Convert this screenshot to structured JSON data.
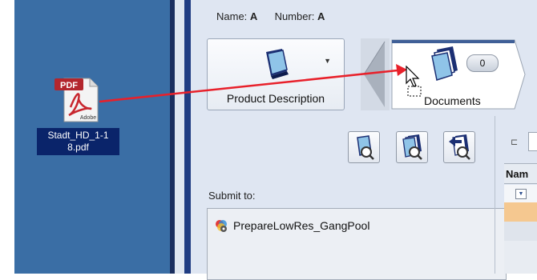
{
  "desktop": {
    "file": {
      "name": "Stadt_HD_1-18.pdf",
      "name_line1": "Stadt_HD_1-1",
      "name_line2": "8.pdf",
      "icon": "pdf-file-icon",
      "icon_badge": "PDF",
      "icon_brand": "Adobe"
    }
  },
  "header": {
    "name_label": "Name:",
    "name_value": "A",
    "number_label": "Number:",
    "number_value": "A"
  },
  "toolbar": {
    "product_description_label": "Product Description",
    "documents_label": "Documents",
    "documents_count": "0"
  },
  "actions": [
    {
      "icon": "view-document-icon"
    },
    {
      "icon": "view-multiple-documents-icon"
    },
    {
      "icon": "search-documents-icon"
    }
  ],
  "submit": {
    "label": "Submit to:",
    "items": [
      {
        "label": "PrepareLowRes_GangPool",
        "icon": "workflow-icon"
      }
    ]
  },
  "table": {
    "header_partial": "Nam"
  },
  "colors": {
    "desktop": "#3a6ea5",
    "app_bg": "#dfe6f2",
    "selected_row": "#f5c890",
    "drag_arrow": "#e8202a"
  }
}
